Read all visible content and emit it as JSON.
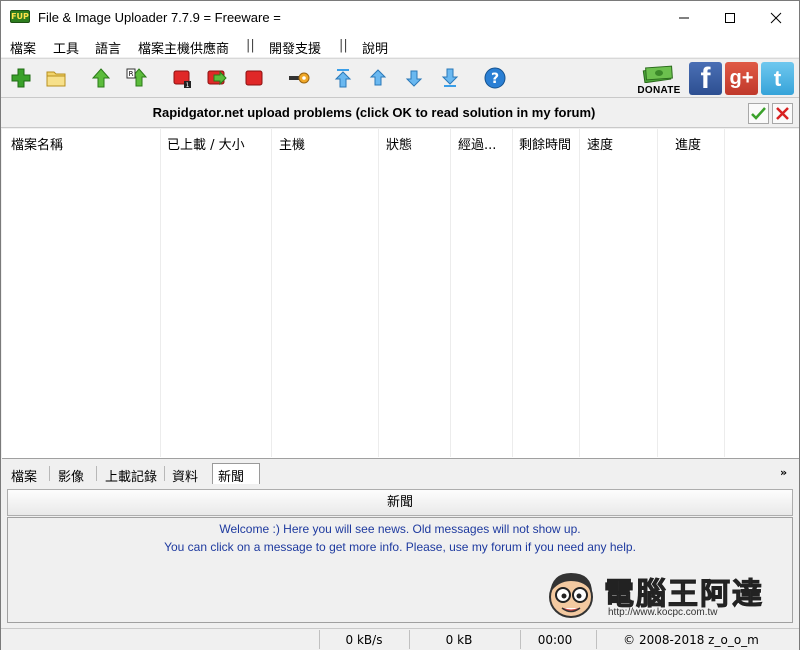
{
  "window": {
    "icon_text": "FUP",
    "title": "File & Image Uploader 7.7.9  = Freeware ="
  },
  "menu": {
    "items": [
      "檔案",
      "工具",
      "語言",
      "檔案主機供應商",
      "開發支援",
      "說明"
    ],
    "separator": "||"
  },
  "toolbar": {
    "buttons": [
      {
        "icon": "add-icon",
        "color": "#3aa12a"
      },
      {
        "icon": "folder-icon",
        "color": "#e8c34a"
      },
      {
        "icon": "upload-icon",
        "color": "#3aa12a"
      },
      {
        "icon": "upload-all-icon",
        "color": "#3aa12a"
      },
      {
        "icon": "stop-icon",
        "color": "#d82020"
      },
      {
        "icon": "skip-icon",
        "color": "#d82020"
      },
      {
        "icon": "stop-all-icon",
        "color": "#d82020"
      },
      {
        "icon": "key-icon",
        "color": "#e8a020"
      },
      {
        "icon": "move-top-icon",
        "color": "#3a9ee8"
      },
      {
        "icon": "move-up-icon",
        "color": "#3a9ee8"
      },
      {
        "icon": "move-down-icon",
        "color": "#3a9ee8"
      },
      {
        "icon": "move-bottom-icon",
        "color": "#3a9ee8"
      },
      {
        "icon": "help-icon",
        "color": "#2a7fd4"
      }
    ],
    "donate_label": "DONATE",
    "social": {
      "facebook": "f",
      "googleplus": "g+",
      "twitter": "t"
    }
  },
  "notice": {
    "text": "Rapidgator.net upload problems (click OK to read solution in my forum)"
  },
  "grid": {
    "columns": [
      "檔案名稱",
      "已上載 / 大小",
      "主機",
      "狀態",
      "經過...",
      "剩餘時間",
      "速度",
      "進度"
    ]
  },
  "tabs": {
    "items": [
      "檔案",
      "影像",
      "上載記錄",
      "資料",
      "新聞"
    ],
    "active": "新聞"
  },
  "news": {
    "button_label": "新聞",
    "messages": [
      "Welcome :) Here you will see news. Old messages will not show up.",
      "You can click on a message to get more info. Please, use my forum if you need any help."
    ]
  },
  "watermark": {
    "title": "電腦王阿達",
    "url": "http://www.kocpc.com.tw"
  },
  "status": {
    "speed": "0 kB/s",
    "size": "0 kB",
    "time": "00:00",
    "copyright": "© 2008-2018 z_o_o_m"
  }
}
